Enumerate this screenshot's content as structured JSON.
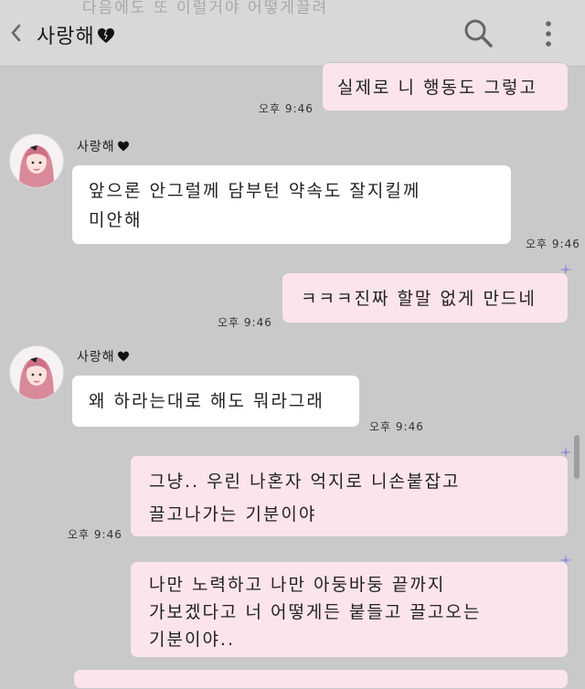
{
  "header": {
    "ghost_text": "다음에도 또 이럴거야 어떻게끌려",
    "title": "사랑해",
    "icons": {
      "back": "chevron-left-icon",
      "heart": "black-heart-icon",
      "search": "search-icon",
      "more": "more-vertical-icon"
    }
  },
  "messages": [
    {
      "from": "me",
      "lines": [
        "실제로 니 행동도 그렇고"
      ],
      "time": "오후 9:46"
    },
    {
      "from": "them",
      "sender": "사랑해",
      "lines": [
        "앞으론 안그럴께 담부턴 약속도 잘지킬께",
        "미안해"
      ],
      "time": "오후 9:46"
    },
    {
      "from": "me",
      "lines": [
        "ㅋㅋㅋ진짜 할말 없게 만드네"
      ],
      "time": "오후 9:46"
    },
    {
      "from": "them",
      "sender": "사랑해",
      "lines": [
        "왜 하라는대로 해도 뭐라그래"
      ],
      "time": "오후 9:46"
    },
    {
      "from": "me",
      "lines": [
        "그냥.. 우린 나혼자 억지로 니손붙잡고",
        "끌고나가는 기분이야"
      ],
      "time": "오후 9:46"
    },
    {
      "from": "me",
      "lines": [
        "나만 노력하고 나만 아둥바둥 끝까지",
        "가보겠다고 너 어떻게든 붙들고 끌고오는",
        "기분이야.."
      ]
    }
  ],
  "colors": {
    "background": "#c9c9cb",
    "mine_bubble": "#fbe4ea",
    "their_bubble": "#ffffff",
    "pin": "#8d8fd6"
  }
}
